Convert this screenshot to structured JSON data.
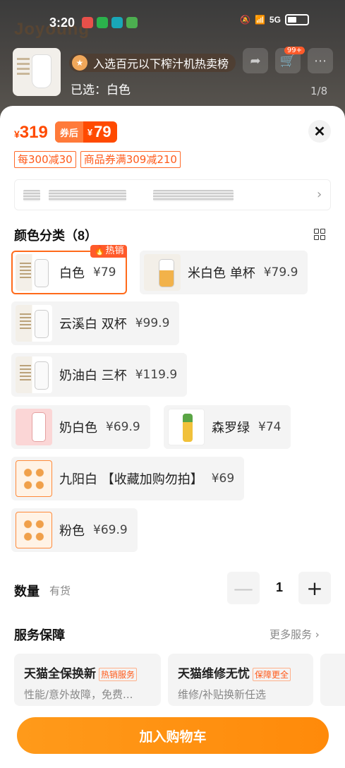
{
  "status_bar": {
    "time": "3:20",
    "network": "5G"
  },
  "backdrop": {
    "brand": "Joyoung",
    "hot_rank_text": "入选百元以下榨汁机热卖榜",
    "selected_text": "已选：白色",
    "cart_badge": "99+",
    "page_indicator": "1/8"
  },
  "price": {
    "currency": "¥",
    "original": "319",
    "after_coupon_label": "券后",
    "after_coupon": "79"
  },
  "promos": [
    "每300减30",
    "商品券满309减210"
  ],
  "color_section": {
    "title": "颜色分类（8）",
    "options": [
      {
        "name": "白色",
        "price": "¥79",
        "hot": "热销"
      },
      {
        "name": "米白色 单杯",
        "price": "¥79.9"
      },
      {
        "name": "云溪白 双杯",
        "price": "¥99.9"
      },
      {
        "name": "奶油白 三杯",
        "price": "¥119.9"
      },
      {
        "name": "奶白色",
        "price": "¥69.9"
      },
      {
        "name": "森罗绿",
        "price": "¥74"
      },
      {
        "name": "九阳白 【收藏加购勿拍】",
        "price": "¥69"
      },
      {
        "name": "粉色",
        "price": "¥69.9"
      }
    ]
  },
  "quantity": {
    "label": "数量",
    "stock": "有货",
    "value": "1",
    "minus": "—",
    "plus": "+"
  },
  "service": {
    "title": "服务保障",
    "more": "更多服务 ›",
    "cards": [
      {
        "name": "天猫全保换新",
        "tag": "热销服务",
        "desc": "性能/意外故障，免费..."
      },
      {
        "name": "天猫维修无忧",
        "tag": "保障更全",
        "desc": "维修/补贴换新任选"
      }
    ]
  },
  "cta_label": "加入购物车",
  "colors": {
    "accent": "#ff4a00",
    "cta": "#ff9000",
    "selected_border": "#ff6a1a"
  }
}
